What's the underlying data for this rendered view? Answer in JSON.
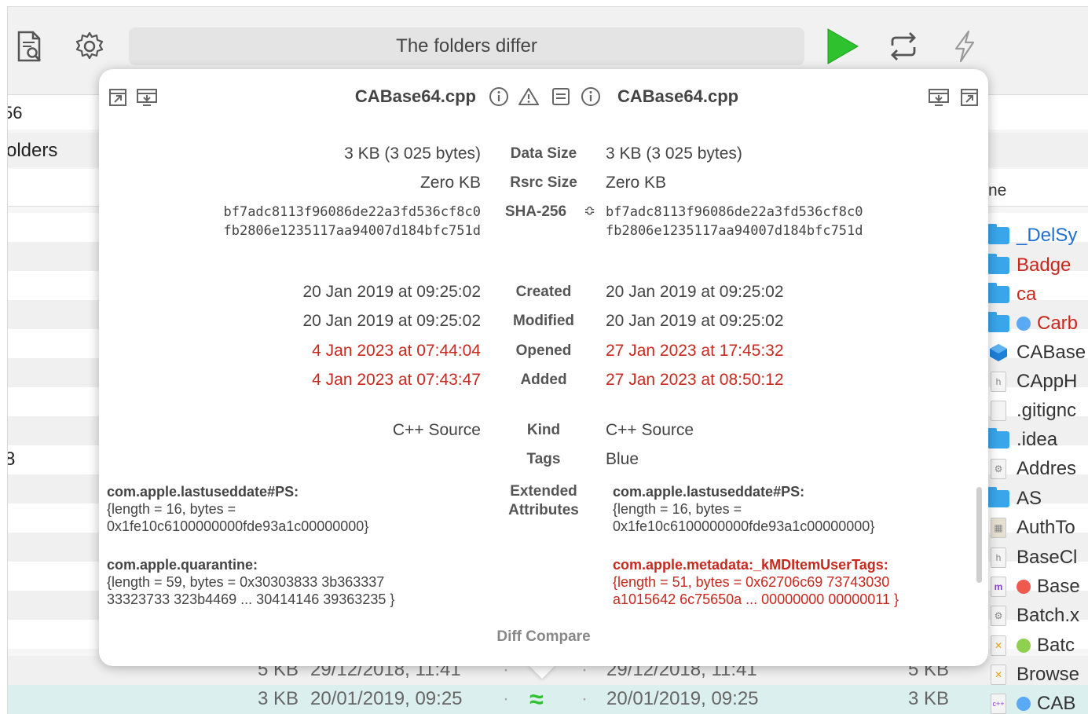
{
  "toolbar": {
    "status_text": "The folders differ",
    "icons": [
      "inspect-document-icon",
      "gear-icon",
      "play-icon",
      "sync-icon",
      "lightning-icon"
    ],
    "play_color": "#2fc22f"
  },
  "background": {
    "left_fragments": [
      "56",
      "olders"
    ],
    "right_header": "ne",
    "right_items": [
      {
        "name": "_DelSy",
        "icon": "folder",
        "color": "#1f6fd1"
      },
      {
        "name": "Badge",
        "icon": "folder",
        "color": "#c8281e"
      },
      {
        "name": "ca",
        "icon": "folder",
        "color": "#c8281e"
      },
      {
        "name": "Carb",
        "icon": "folder",
        "color": "#c8281e",
        "dot": "#5aa9f5"
      },
      {
        "name": "CABase",
        "icon": "cube",
        "color": "#222"
      },
      {
        "name": "CAppH",
        "icon": "h",
        "color": "#222"
      },
      {
        "name": ".gitignc",
        "icon": "doc",
        "color": "#222"
      },
      {
        "name": ".idea",
        "icon": "folder",
        "color": "#222"
      },
      {
        "name": "Addres",
        "icon": "gear",
        "color": "#222"
      },
      {
        "name": "AS",
        "icon": "folder",
        "color": "#222"
      },
      {
        "name": "AuthTo",
        "icon": "img",
        "color": "#222"
      },
      {
        "name": "BaseCl",
        "icon": "h",
        "color": "#222"
      },
      {
        "name": "Base",
        "icon": "m",
        "color": "#222",
        "dot": "#ee5a4e"
      },
      {
        "name": "Batch.x",
        "icon": "gear",
        "color": "#222"
      },
      {
        "name": "Batc",
        "icon": "x",
        "color": "#222",
        "dot": "#8fd14f"
      },
      {
        "name": "Browse",
        "icon": "x",
        "color": "#222"
      },
      {
        "name": "CAB",
        "icon": "cpp",
        "color": "#222",
        "dot": "#5aa9f5"
      }
    ],
    "rows_bottom": [
      {
        "size_l": "5 KB",
        "date_l": "29/12/2018, 11:41",
        "date_r": "29/12/2018, 11:41",
        "size_r": "5 KB"
      },
      {
        "size_l": "3 KB",
        "date_l": "20/01/2019, 09:25",
        "date_r": "20/01/2019, 09:25",
        "size_r": "3 KB",
        "mark": "≈"
      }
    ],
    "left_mark": "8"
  },
  "popover": {
    "left_file": "CABase64.cpp",
    "right_file": "CABase64.cpp",
    "data_size": {
      "label": "Data Size",
      "left": "3 KB (3 025 bytes)",
      "right": "3 KB (3 025 bytes)"
    },
    "rsrc_size": {
      "label": "Rsrc Size",
      "left": "Zero KB",
      "right": "Zero KB"
    },
    "sha": {
      "label": "SHA-256",
      "stepper": "≎",
      "left_1": "bf7adc8113f96086de22a3fd536cf8c0",
      "left_2": "fb2806e1235117aa94007d184bfc751d",
      "right_1": "bf7adc8113f96086de22a3fd536cf8c0",
      "right_2": "fb2806e1235117aa94007d184bfc751d"
    },
    "created": {
      "label": "Created",
      "left": "20 Jan 2019 at 09:25:02",
      "right": "20 Jan 2019 at 09:25:02"
    },
    "modified": {
      "label": "Modified",
      "left": "20 Jan 2019 at 09:25:02",
      "right": "20 Jan 2019 at 09:25:02"
    },
    "opened": {
      "label": "Opened",
      "left": "4 Jan 2023 at 07:44:04",
      "right": "27 Jan 2023 at 17:45:32"
    },
    "added": {
      "label": "Added",
      "left": "4 Jan 2023 at 07:43:47",
      "right": "27 Jan 2023 at 08:50:12"
    },
    "kind": {
      "label": "Kind",
      "left": "C++ Source",
      "right": "C++ Source"
    },
    "tags": {
      "label": "Tags",
      "right": "Blue"
    },
    "xattr_label_1": "Extended",
    "xattr_label_2": "Attributes",
    "left_attrs": [
      {
        "key": "com.apple.lastuseddate#PS:",
        "lines": [
          "{length = 16, bytes =",
          "0x1fe10c6100000000fde93a1c00000000}"
        ]
      },
      {
        "key": "com.apple.quarantine:",
        "lines": [
          "{length = 59, bytes = 0x30303833 3b363337",
          "33323733 323b4469 ... 30414146 39363235 }"
        ]
      }
    ],
    "right_attrs": [
      {
        "key": "com.apple.lastuseddate#PS:",
        "lines": [
          "{length = 16, bytes =",
          "0x1fe10c6100000000fde93a1c00000000}"
        ]
      },
      {
        "key": "com.apple.metadata:_kMDItemUserTags:",
        "lines": [
          "{length = 51, bytes = 0x62706c69 73743030",
          "a1015642 6c75650a ... 00000000 00000011 }"
        ]
      }
    ],
    "footer": "Diff Compare",
    "header_icons": [
      "export-left-icon",
      "copy-left-icon",
      "info-icon",
      "warning-icon",
      "list-icon",
      "info-icon",
      "copy-right-icon",
      "export-right-icon"
    ],
    "diff_color": "#c8281e"
  }
}
